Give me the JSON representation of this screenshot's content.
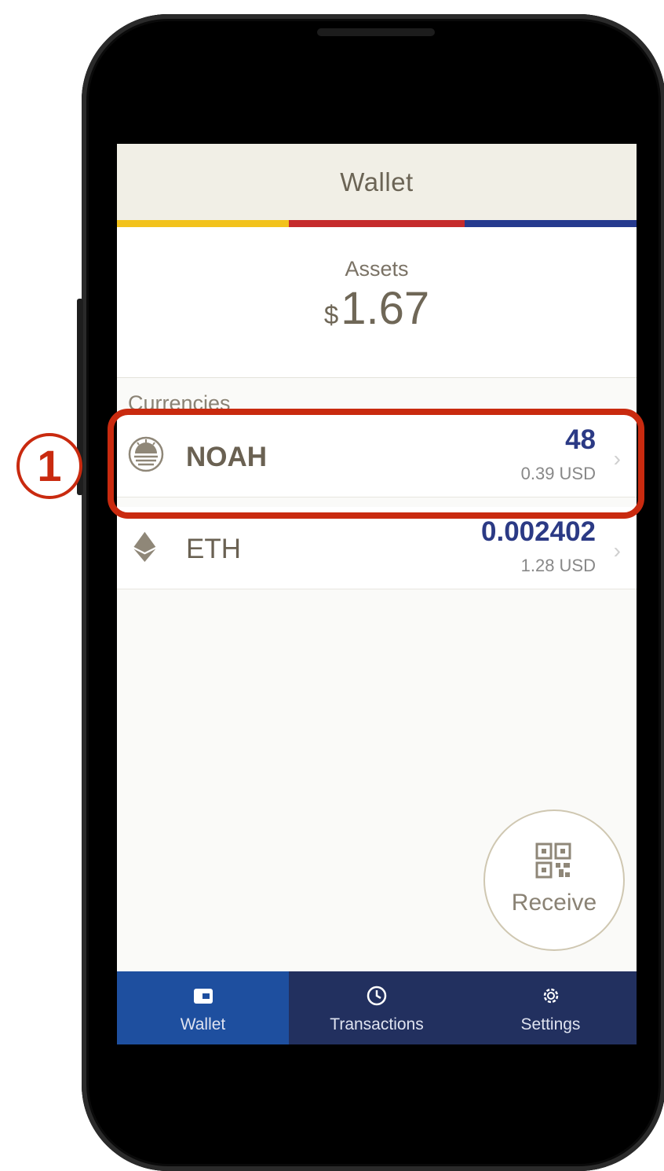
{
  "header": {
    "title": "Wallet"
  },
  "assets": {
    "label": "Assets",
    "currency_symbol": "$",
    "value": "1.67"
  },
  "currencies": {
    "section_label": "Currencies",
    "items": [
      {
        "name": "NOAH",
        "amount": "48",
        "usd": "0.39 USD",
        "icon": "noah-coin-icon"
      },
      {
        "name": "ETH",
        "amount": "0.002402",
        "usd": "1.28 USD",
        "icon": "eth-diamond-icon"
      }
    ]
  },
  "receive": {
    "label": "Receive",
    "icon": "qr-code-icon"
  },
  "tabs": [
    {
      "label": "Wallet",
      "icon": "wallet-icon",
      "active": true
    },
    {
      "label": "Transactions",
      "icon": "clock-icon",
      "active": false
    },
    {
      "label": "Settings",
      "icon": "gear-icon",
      "active": false
    }
  ],
  "callout": {
    "number": "1"
  },
  "colors": {
    "stripe_yellow": "#f2c21c",
    "stripe_red": "#c52b2c",
    "stripe_blue": "#263a8e",
    "amount_blue": "#2b3a85",
    "tab_active": "#1e4f9f",
    "tab_bar": "#22305f",
    "callout_red": "#c92a0f"
  }
}
